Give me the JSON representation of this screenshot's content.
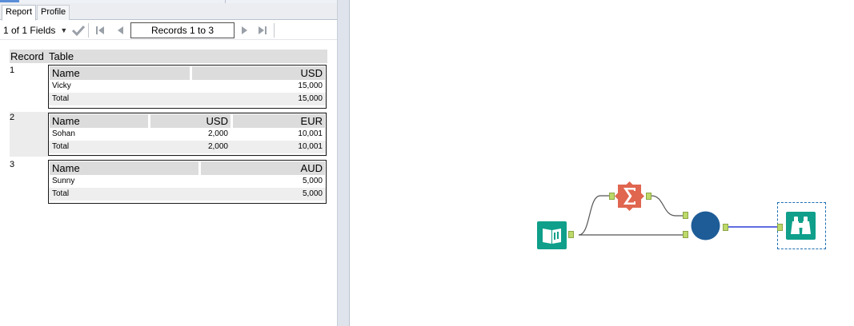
{
  "tabs": [
    {
      "label": "Report",
      "active": true
    },
    {
      "label": "Profile",
      "active": false
    }
  ],
  "toolbar": {
    "fields_label": "1 of 1 Fields",
    "records_label": "Records 1 to 3"
  },
  "grid": {
    "columns": [
      "Record",
      "Table"
    ],
    "records": [
      {
        "number": "1",
        "headers": [
          "Name",
          "USD"
        ],
        "rows": [
          [
            "Vicky",
            "15,000"
          ],
          [
            "Total",
            "15,000"
          ]
        ]
      },
      {
        "number": "2",
        "headers": [
          "Name",
          "USD",
          "EUR"
        ],
        "rows": [
          [
            "Sohan",
            "2,000",
            "10,001"
          ],
          [
            "Total",
            "2,000",
            "10,001"
          ]
        ]
      },
      {
        "number": "3",
        "headers": [
          "Name",
          "AUD"
        ],
        "rows": [
          [
            "Sunny",
            "5,000"
          ],
          [
            "Total",
            "5,000"
          ]
        ]
      }
    ]
  },
  "workflow": {
    "tools": [
      "input-data-tool",
      "summarize-tool",
      "join-tool",
      "browse-tool"
    ],
    "colors": {
      "input": "#0f9f8a",
      "summarize": "#e0664f",
      "join": "#1d5c97",
      "browse": "#0f9f8a",
      "connection_selected": "#2a3fd8",
      "connection": "#555555",
      "anchor": "#bcd96a"
    }
  }
}
